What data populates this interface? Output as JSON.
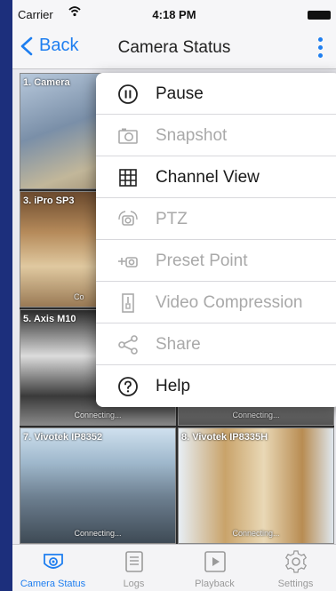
{
  "status_bar": {
    "carrier": "Carrier",
    "time": "4:18 PM"
  },
  "nav": {
    "back_label": "Back",
    "title": "Camera Status"
  },
  "cameras": [
    {
      "label": "1. Camera",
      "status": ""
    },
    {
      "label": "",
      "status": ""
    },
    {
      "label": "3. iPro SP3",
      "status": "Co"
    },
    {
      "label": "",
      "status": ""
    },
    {
      "label": "5. Axis M10",
      "status": "Connecting..."
    },
    {
      "label": "",
      "status": "Connecting..."
    },
    {
      "label": "7. Vivotek IP8352",
      "status": "Connecting..."
    },
    {
      "label": "8. Vivotek IP8335H",
      "status": "Connecting..."
    }
  ],
  "menu": [
    {
      "label": "Pause",
      "icon": "pause-icon",
      "enabled": true
    },
    {
      "label": "Snapshot",
      "icon": "camera-icon",
      "enabled": false
    },
    {
      "label": "Channel View",
      "icon": "grid-icon",
      "enabled": true
    },
    {
      "label": "PTZ",
      "icon": "ptz-icon",
      "enabled": false
    },
    {
      "label": "Preset Point",
      "icon": "preset-point-icon",
      "enabled": false
    },
    {
      "label": "Video Compression",
      "icon": "compression-icon",
      "enabled": false
    },
    {
      "label": "Share",
      "icon": "share-icon",
      "enabled": false
    },
    {
      "label": "Help",
      "icon": "help-icon",
      "enabled": true
    }
  ],
  "tabs": [
    {
      "label": "Camera Status",
      "icon": "camera-status-icon",
      "active": true
    },
    {
      "label": "Logs",
      "icon": "logs-icon",
      "active": false
    },
    {
      "label": "Playback",
      "icon": "playback-icon",
      "active": false
    },
    {
      "label": "Settings",
      "icon": "settings-icon",
      "active": false
    }
  ],
  "colors": {
    "accent": "#1e7ef0",
    "disabled_text": "#a9a9a9",
    "background": "#1c2f7c"
  }
}
